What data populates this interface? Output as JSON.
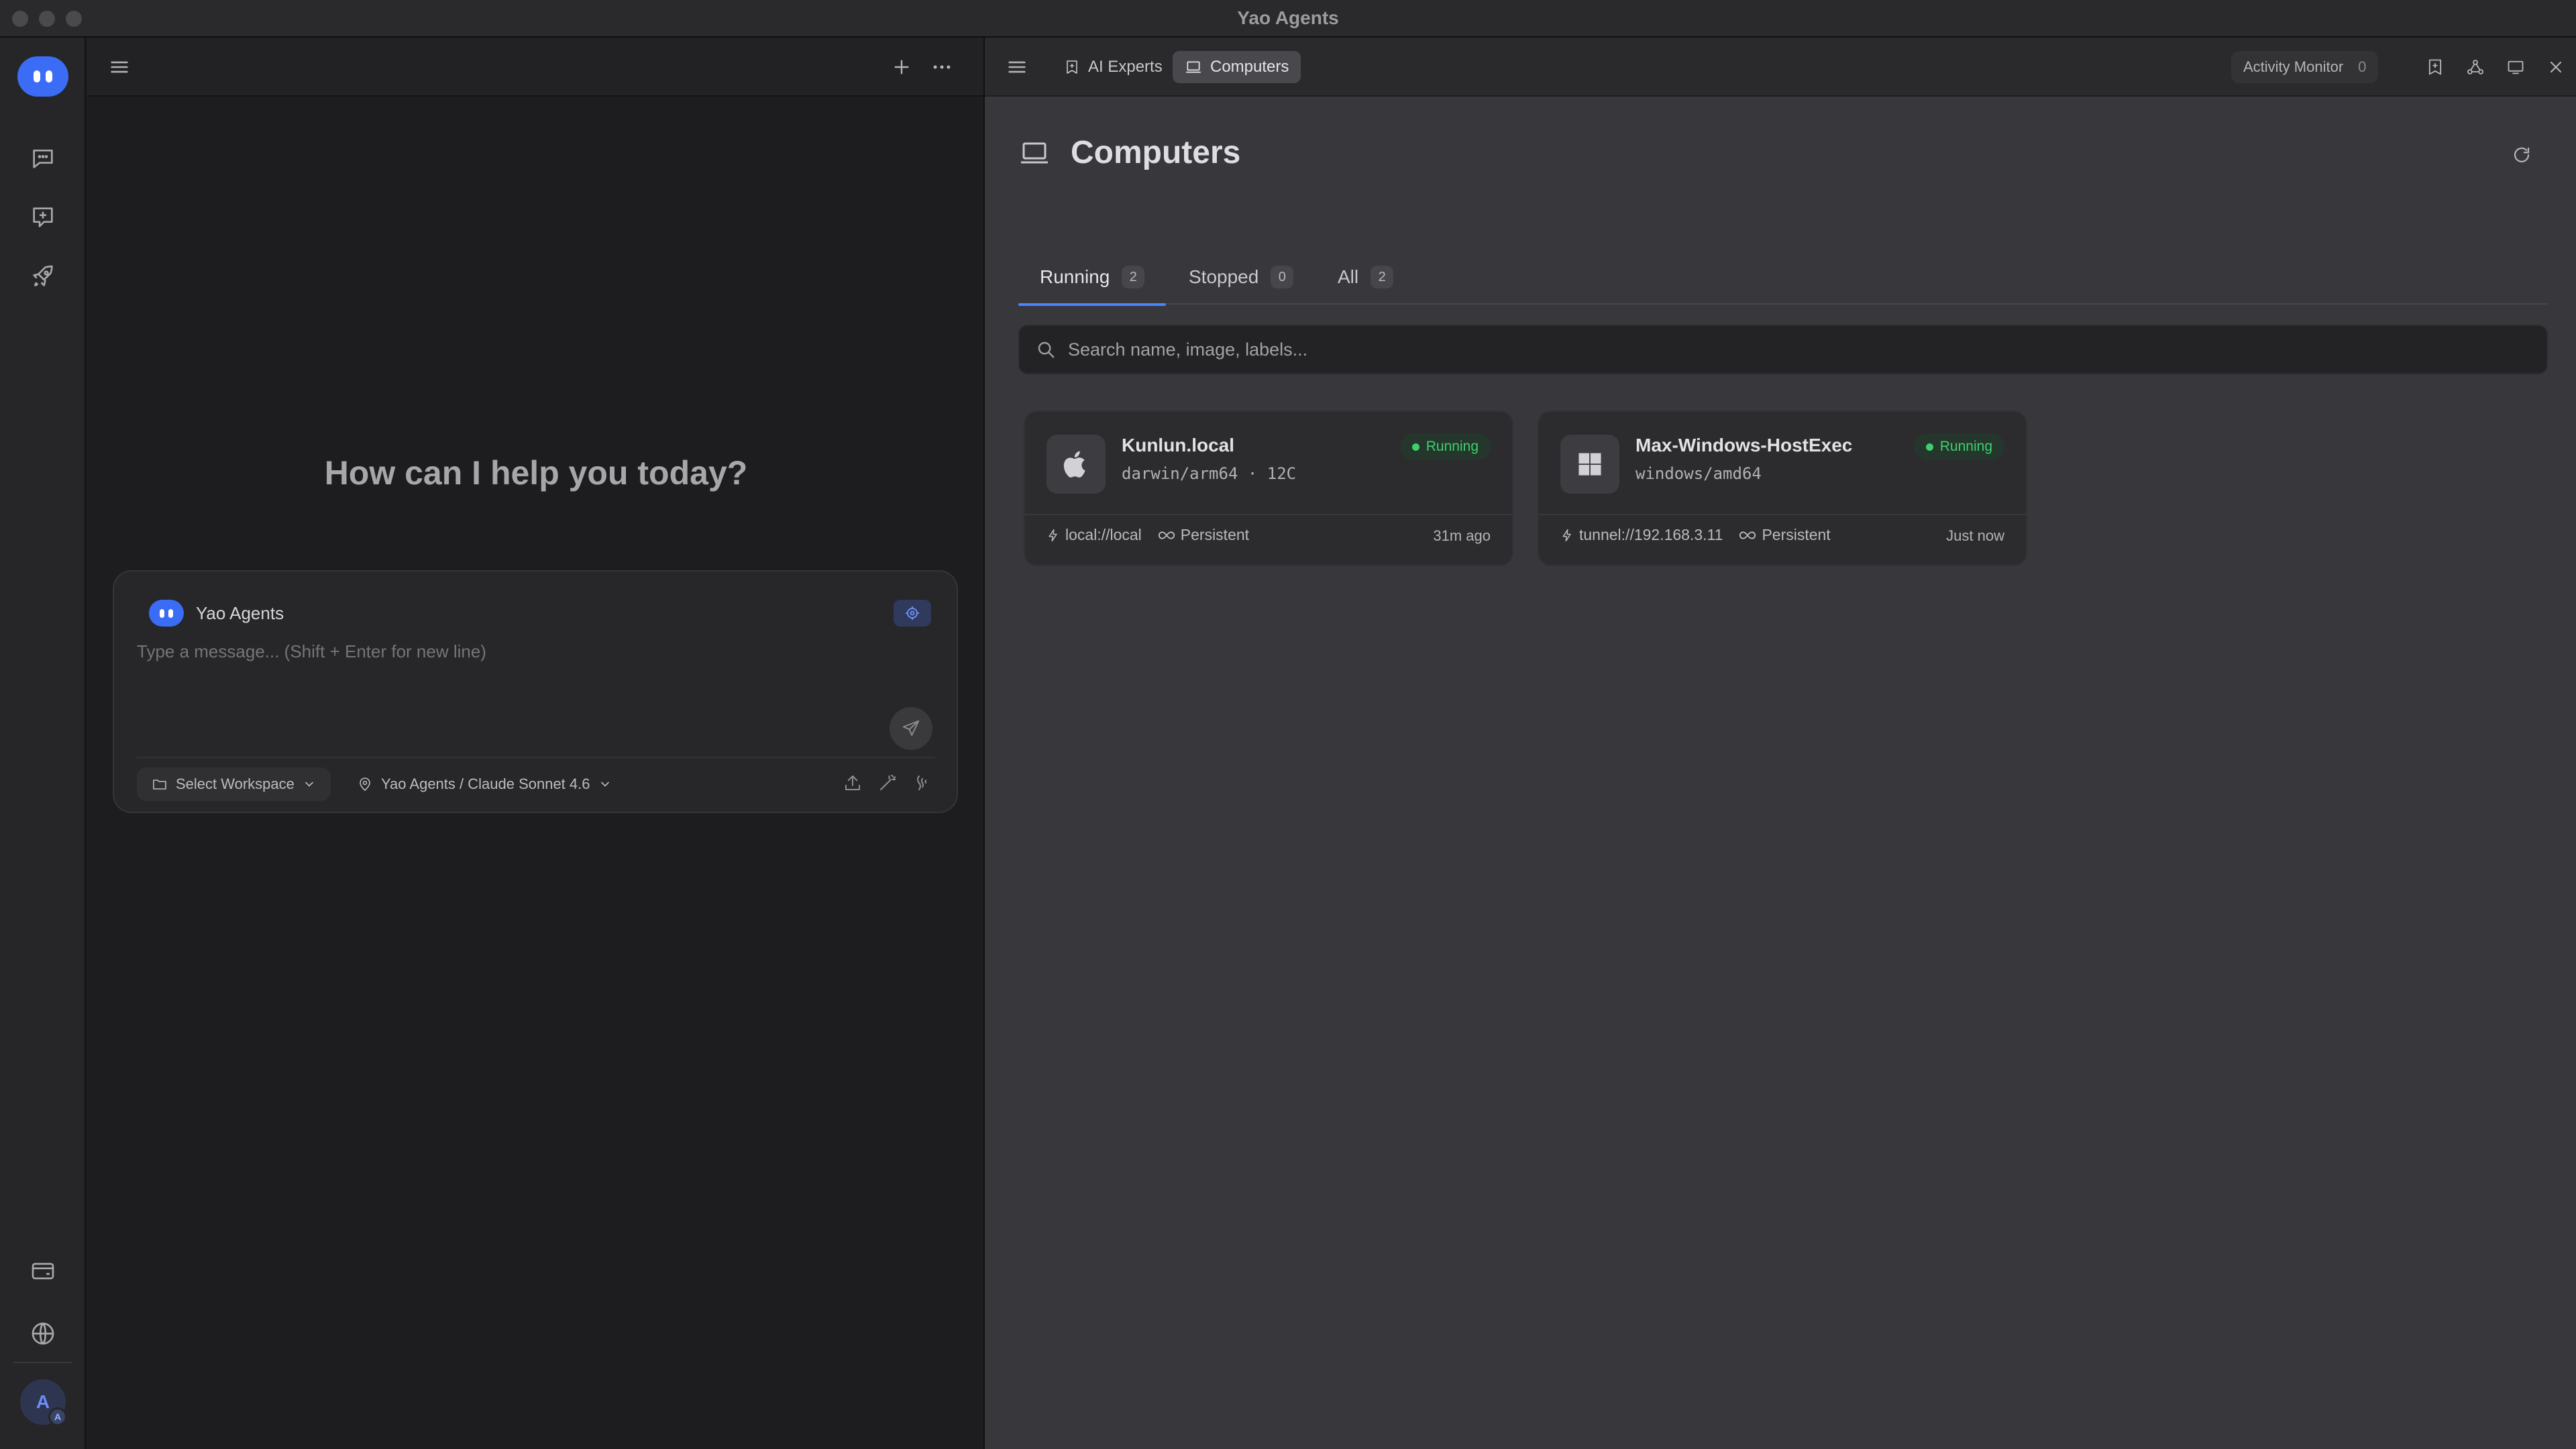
{
  "window": {
    "title": "Yao Agents"
  },
  "chat": {
    "greeting": "How can I help you today?",
    "composer": {
      "agent_name": "Yao Agents",
      "placeholder": "Type a message... (Shift + Enter for new line)",
      "workspace_label": "Select Workspace",
      "model_label": "Yao Agents / Claude Sonnet 4.6"
    }
  },
  "right": {
    "tabs": [
      {
        "label": "AI Experts"
      },
      {
        "label": "Computers"
      }
    ],
    "activity": {
      "label": "Activity Monitor",
      "count": "0"
    },
    "page_title": "Computers",
    "filters": [
      {
        "label": "Running",
        "count": "2"
      },
      {
        "label": "Stopped",
        "count": "0"
      },
      {
        "label": "All",
        "count": "2"
      }
    ],
    "search_placeholder": "Search name, image, labels...",
    "computers": [
      {
        "name": "Kunlun.local",
        "arch": "darwin/arm64 · 12C",
        "status": "Running",
        "endpoint": "local://local",
        "mode": "Persistent",
        "time": "31m ago",
        "os_icon": "apple-icon"
      },
      {
        "name": "Max-Windows-HostExec",
        "arch": "windows/amd64",
        "status": "Running",
        "endpoint": "tunnel://192.168.3.11",
        "mode": "Persistent",
        "time": "Just now",
        "os_icon": "windows-icon"
      }
    ]
  },
  "user": {
    "initial": "A",
    "sub_initial": "A"
  },
  "colors": {
    "accent": "#4a84ff",
    "brand": "#3b6cf6",
    "running": "#3fcf6e"
  }
}
